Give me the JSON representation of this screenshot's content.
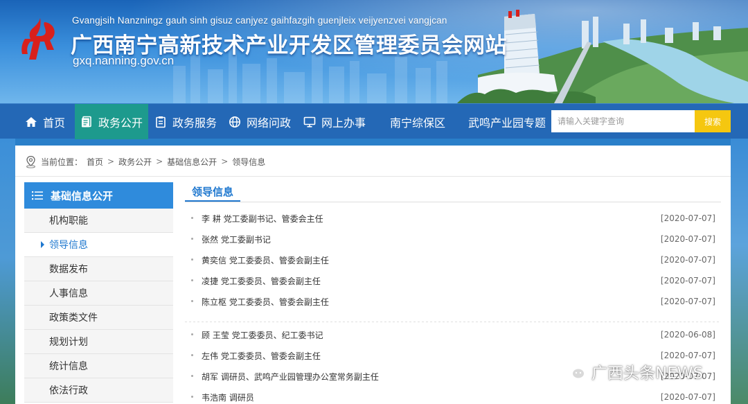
{
  "banner": {
    "roman_title": "Gvangjsih Nanzningz gauh sinh gisuz canjyez gaihfazgih guenjleix veijyenzvei vangjcan",
    "title": "广西南宁高新技术产业开发区管理委员会网站",
    "domain": "gxq.nanning.gov.cn",
    "logo_color": "#d8201c"
  },
  "nav": {
    "items": [
      {
        "label": "首页",
        "icon": "home-icon"
      },
      {
        "label": "政务公开",
        "icon": "document-icon"
      },
      {
        "label": "政务服务",
        "icon": "clipboard-icon"
      },
      {
        "label": "网络问政",
        "icon": "globe-icon"
      },
      {
        "label": "网上办事",
        "icon": "monitor-icon"
      },
      {
        "label": "南宁综保区",
        "icon": ""
      },
      {
        "label": "武鸣产业园专题",
        "icon": ""
      }
    ],
    "active_index": 1,
    "search_placeholder": "请输入关键字查询",
    "search_button": "搜索",
    "bar_color": "#2468b6",
    "active_color": "#1d9a8d",
    "search_button_color": "#f5c710"
  },
  "breadcrumb": {
    "label": "当前位置：",
    "items": [
      "首页",
      "政务公开",
      "基础信息公开",
      "领导信息"
    ],
    "separator": ">"
  },
  "sidebar": {
    "title": "基础信息公开",
    "items": [
      {
        "label": "机构职能"
      },
      {
        "label": "领导信息"
      },
      {
        "label": "数据发布"
      },
      {
        "label": "人事信息"
      },
      {
        "label": "政策类文件"
      },
      {
        "label": "规划计划"
      },
      {
        "label": "统计信息"
      },
      {
        "label": "依法行政"
      }
    ],
    "active_index": 1,
    "header_color": "#2f8bdc"
  },
  "content": {
    "title": "领导信息",
    "rows": [
      {
        "name": "李 耕 党工委副书记、管委会主任",
        "date": "[2020-07-07]"
      },
      {
        "name": "张然 党工委副书记",
        "date": "[2020-07-07]"
      },
      {
        "name": "黄奕信 党工委委员、管委会副主任",
        "date": "[2020-07-07]"
      },
      {
        "name": "凌捷 党工委委员、管委会副主任",
        "date": "[2020-07-07]"
      },
      {
        "name": "陈立枢 党工委委员、管委会副主任",
        "date": "[2020-07-07]"
      },
      {
        "name": "顾 王莹 党工委委员、纪工委书记",
        "date": "[2020-06-08]"
      },
      {
        "name": "左伟 党工委委员、管委会副主任",
        "date": "[2020-07-07]"
      },
      {
        "name": "胡军 调研员、武鸣产业园管理办公室常务副主任",
        "date": "[2020-07-07]"
      },
      {
        "name": "韦浩南 调研员",
        "date": "[2020-07-07]"
      }
    ]
  },
  "watermark": {
    "text": "广西头条NEWS",
    "icon": "wechat-icon"
  }
}
